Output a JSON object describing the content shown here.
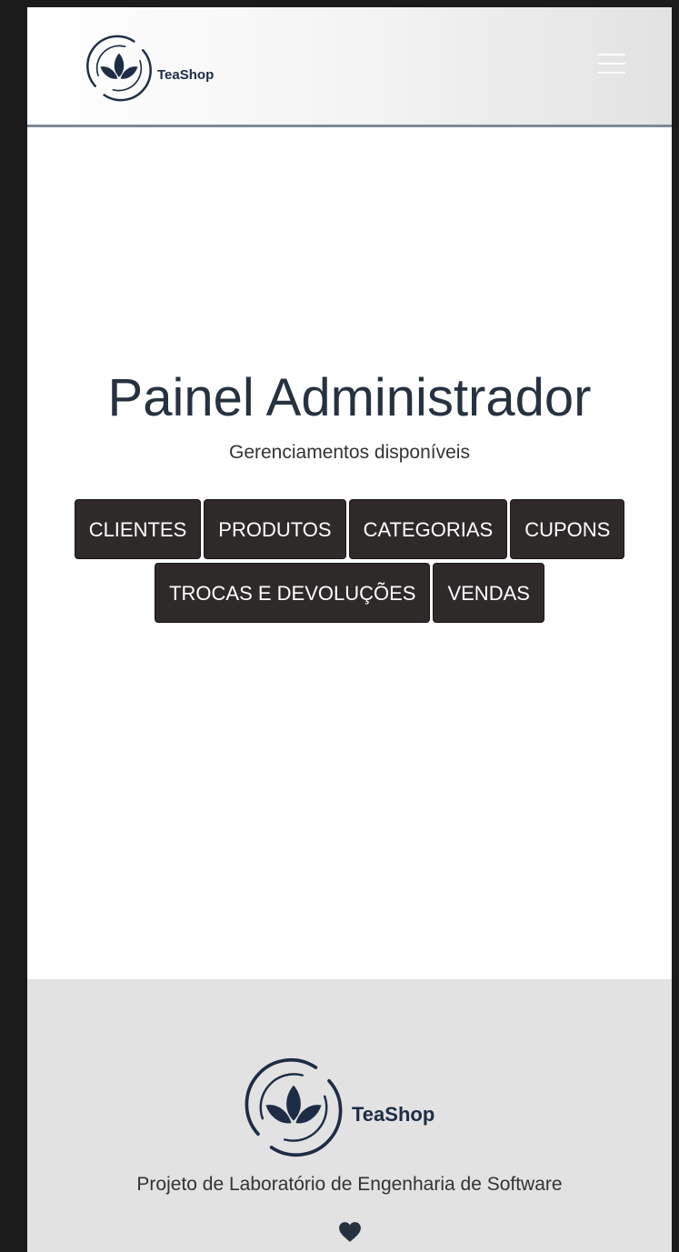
{
  "navbar": {
    "brand_name": "TeaShop",
    "menu_toggle_icon": "hamburger-icon"
  },
  "hero": {
    "title": "Painel Administrador",
    "subtitle": "Gerenciamentos disponíveis"
  },
  "management_buttons": [
    {
      "label": "CLIENTES"
    },
    {
      "label": "PRODUTOS"
    },
    {
      "label": "CATEGORIAS"
    },
    {
      "label": "CUPONS"
    },
    {
      "label": "TROCAS E DEVOLUÇÕES"
    },
    {
      "label": "VENDAS"
    }
  ],
  "footer": {
    "brand_name": "TeaShop",
    "project_text": "Projeto de Laboratório de Engenharia de Software",
    "heart_icon": "heart-icon"
  },
  "colors": {
    "button_bg": "#2e2a29",
    "logo_navy": "#1e2d45",
    "footer_bg": "#e2e2e2"
  }
}
